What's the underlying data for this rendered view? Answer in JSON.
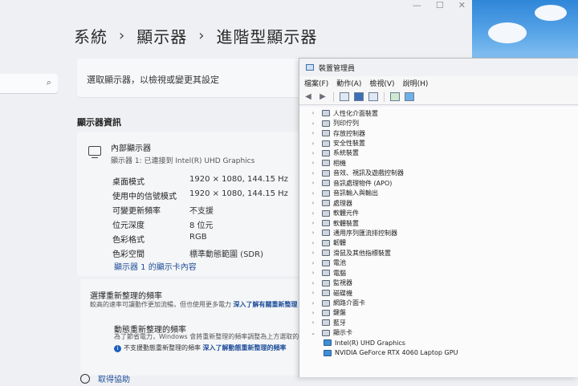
{
  "breadcrumb": [
    "系統",
    "顯示器",
    "進階型顯示器"
  ],
  "breadcrumb_sep": "›",
  "search_icon": "⌕",
  "select_prompt": "選取顯示器，以檢視或變更其設定",
  "section_title": "顯示器資訊",
  "display": {
    "name": "內部顯示器",
    "sub": "顯示器 1: 已連接到 Intel(R) UHD Graphics",
    "rows": [
      {
        "k": "桌面模式",
        "v": "1920 × 1080, 144.15 Hz"
      },
      {
        "k": "使用中的信號模式",
        "v": "1920 × 1080, 144.15 Hz"
      },
      {
        "k": "可變更新頻率",
        "v": "不支援"
      },
      {
        "k": "位元深度",
        "v": "8 位元"
      },
      {
        "k": "色彩格式",
        "v": "RGB"
      },
      {
        "k": "色彩空間",
        "v": "標準動態範圍 (SDR)"
      }
    ],
    "adapter_link": "顯示器 1 的顯示卡內容"
  },
  "refresh": {
    "title": "選擇重新整理的頻率",
    "desc": "較高的速率可讓動作更加流暢，但也使用更多電力",
    "desc_link": "深入了解有關重新整理",
    "dyn_title": "動態重新整理的頻率",
    "dyn_desc": "為了節省電力，Windows 會將重新整理的頻率調整為上方選取的",
    "dyn_note": "不支援動態重新整理的頻率",
    "dyn_link": "深入了解動態重新整理的頻率"
  },
  "help": "取得協助",
  "device_manager": {
    "title": "裝置管理員",
    "menu": [
      "檔案(F)",
      "動作(A)",
      "檢視(V)",
      "說明(H)"
    ],
    "categories": [
      "人性化介面裝置",
      "列印佇列",
      "存放控制器",
      "安全性裝置",
      "系統裝置",
      "相機",
      "音效、視訊及遊戲控制器",
      "音訊處理物件 (APO)",
      "音訊輸入與輸出",
      "處理器",
      "軟體元件",
      "軟體裝置",
      "通用序列匯流排控制器",
      "韌體",
      "滑鼠及其他指標裝置",
      "電池",
      "電腦",
      "監視器",
      "磁碟機",
      "網路介面卡",
      "鍵盤",
      "藍牙",
      "顯示卡"
    ],
    "expanded_children": [
      "Intel(R) UHD Graphics",
      "NVIDIA GeForce RTX 4060 Laptop GPU"
    ]
  }
}
